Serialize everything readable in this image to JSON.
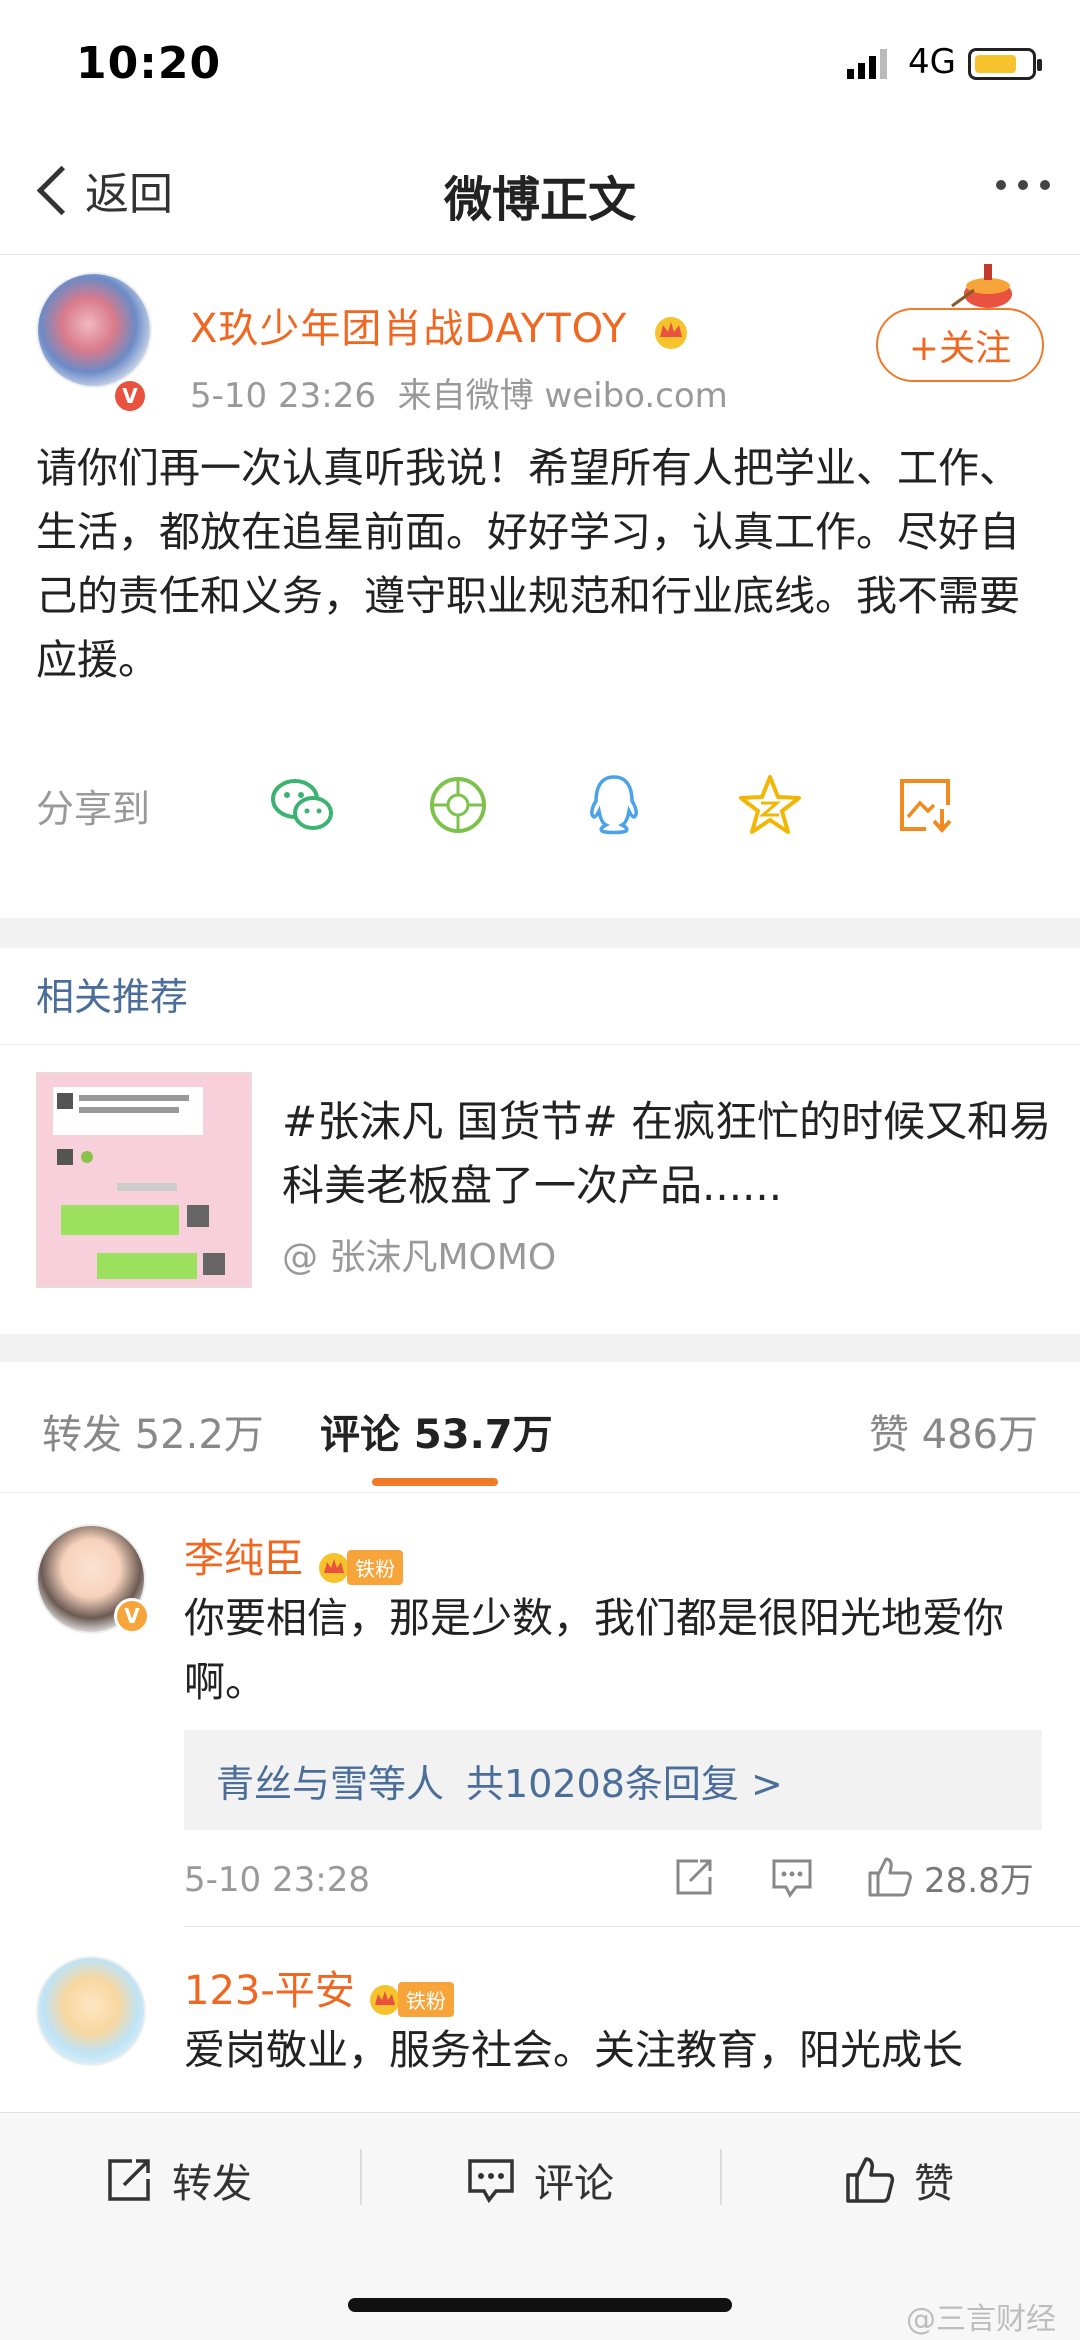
{
  "status_bar": {
    "time": "10:20",
    "network": "4G",
    "battery_level": 0.75
  },
  "nav": {
    "back_label": "返回",
    "title": "微博正文"
  },
  "post": {
    "author": "X玖少年团肖战DAYTOY",
    "time": "5-10 23:26",
    "source": "来自微博 weibo.com",
    "follow_label": "+关注",
    "text": "请你们再一次认真听我说！希望所有人把学业、工作、生活，都放在追星前面。好好学习，认真工作。尽好自己的责任和义务，遵守职业规范和行业底线。我不需要应援。"
  },
  "share": {
    "label": "分享到",
    "icons": [
      "wechat-icon",
      "moments-icon",
      "qq-icon",
      "qzone-icon",
      "save-image-icon"
    ]
  },
  "related": {
    "title": "相关推荐",
    "item": {
      "title": "#张沫凡 国货节# 在疯狂忙的时候又和易科美老板盘了一次产品......",
      "author": "@ 张沫凡MOMO"
    }
  },
  "tabs": [
    {
      "label": "转发 52.2万"
    },
    {
      "label": "评论 53.7万"
    },
    {
      "label": "赞 486万"
    }
  ],
  "comments": [
    {
      "name": "李纯臣",
      "badge": "铁粉",
      "text": "你要相信，那是少数，我们都是很阳光地爱你啊。",
      "reply_users": "青丝与雪等人",
      "reply_count": "共10208条回复 >",
      "time": "5-10 23:28",
      "likes": "28.8万"
    },
    {
      "name": "123-平安",
      "badge": "铁粉",
      "text": "爱岗敬业，服务社会。关注教育，阳光成长"
    }
  ],
  "bottom_bar": {
    "repost": "转发",
    "comment": "评论",
    "like": "赞"
  },
  "watermark": "@三言财经",
  "colors": {
    "accent": "#f06722",
    "link": "#4a6d9a",
    "background": "#ffffff"
  }
}
